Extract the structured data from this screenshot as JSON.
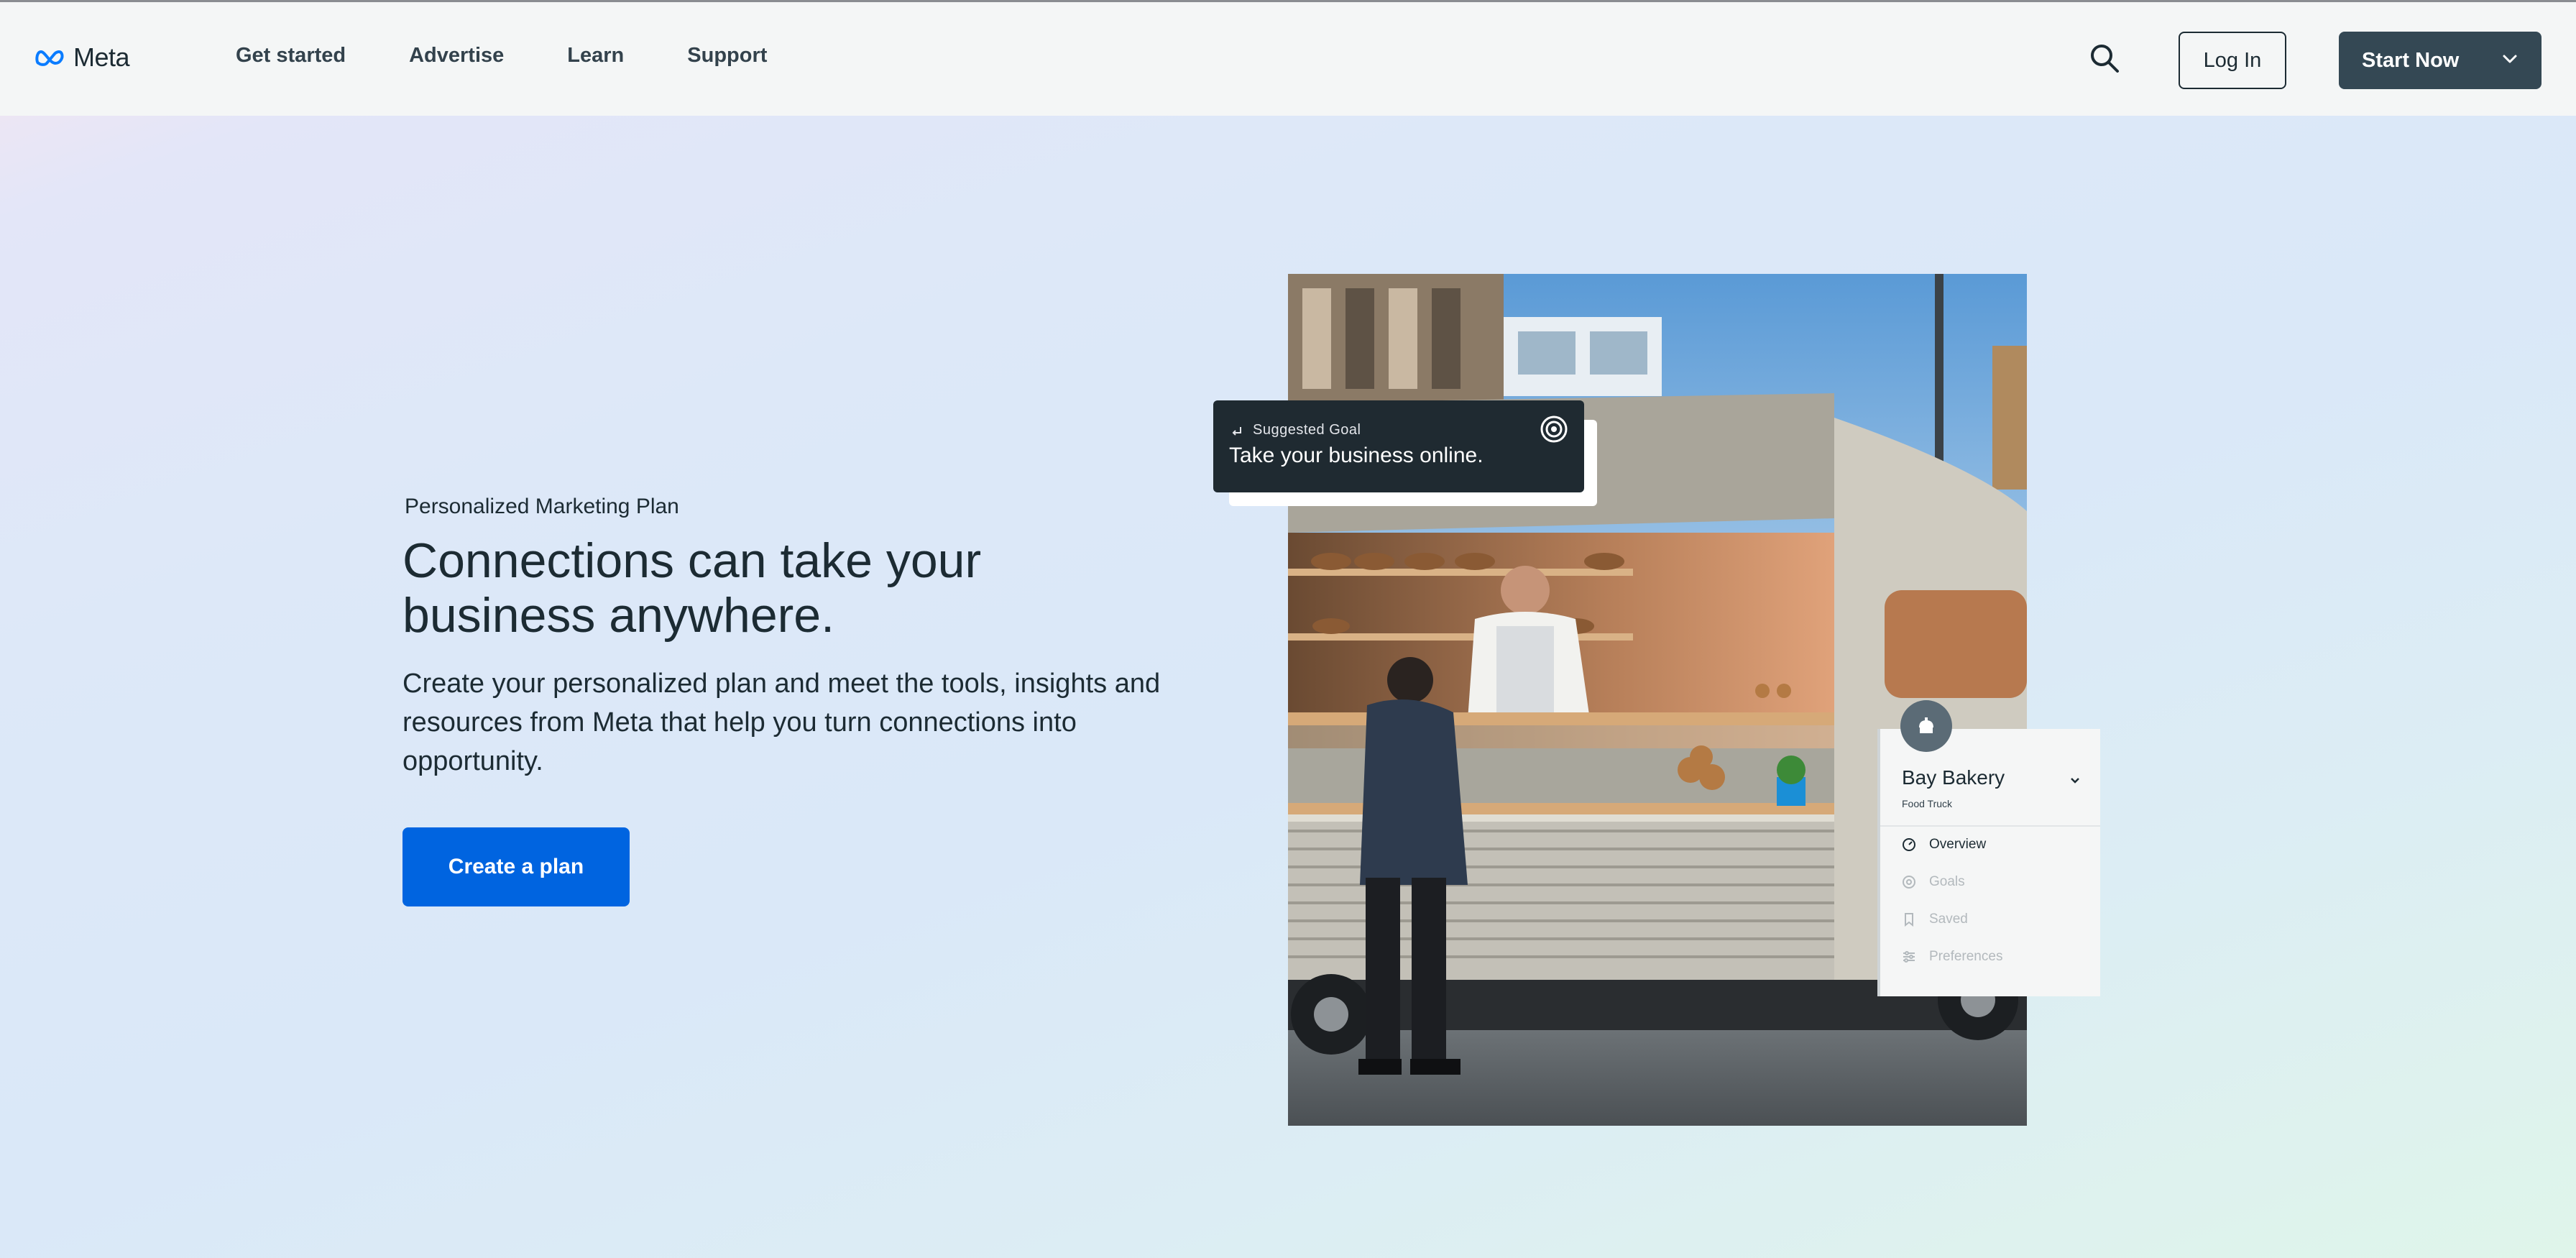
{
  "header": {
    "logo_text": "Meta",
    "nav": [
      "Get started",
      "Advertise",
      "Learn",
      "Support"
    ],
    "login_label": "Log In",
    "start_label": "Start Now"
  },
  "hero": {
    "eyebrow": "Personalized Marketing Plan",
    "headline": "Connections can take your business anywhere.",
    "subtext": "Create your personalized plan and meet the tools, insights and resources from Meta that help you turn connections into opportunity.",
    "cta_label": "Create a plan"
  },
  "goal_card": {
    "label": "Suggested Goal",
    "title": "Take your business online."
  },
  "business_panel": {
    "name": "Bay Bakery",
    "subtitle": "Food Truck",
    "menu": [
      {
        "label": "Overview",
        "icon": "dashboard-icon",
        "active": true
      },
      {
        "label": "Goals",
        "icon": "target-icon",
        "active": false
      },
      {
        "label": "Saved",
        "icon": "bookmark-icon",
        "active": false
      },
      {
        "label": "Preferences",
        "icon": "sliders-icon",
        "active": false
      }
    ]
  },
  "colors": {
    "primary": "#0064e0",
    "dark": "#344854",
    "text": "#1c2b33"
  }
}
